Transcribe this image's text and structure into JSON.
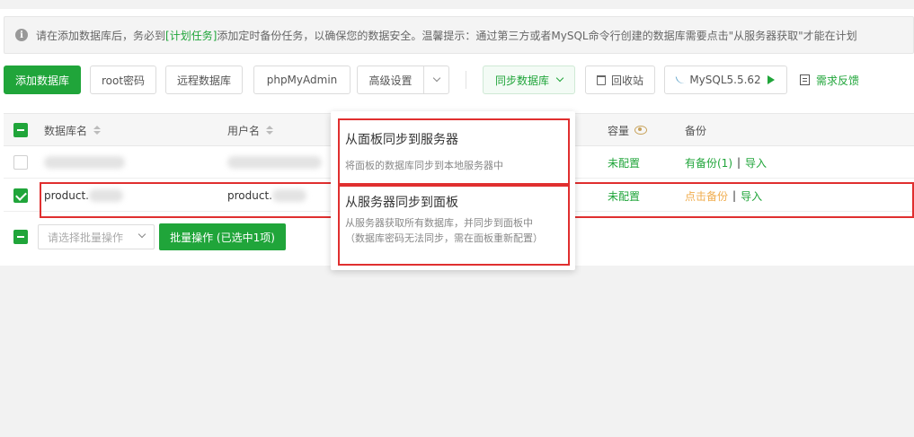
{
  "notice": {
    "text_before": "请在添加数据库后，务必到",
    "link": "[计划任务]",
    "text_after": "添加定时备份任务，以确保您的数据安全。温馨提示：通过第三方或者MySQL命令行创建的数据库需要点击\"从服务器获取\"才能在计划"
  },
  "toolbar": {
    "add_db": "添加数据库",
    "root_pwd": "root密码",
    "remote_db": "远程数据库",
    "phpmyadmin": "phpMyAdmin",
    "advanced": "高级设置",
    "sync_db": "同步数据库",
    "recycle": "回收站",
    "mysql_version": "MySQL5.5.62",
    "feedback": "需求反馈"
  },
  "table": {
    "headers": {
      "db_name": "数据库名",
      "username": "用户名",
      "capacity": "容量",
      "backup": "备份"
    },
    "rows": [
      {
        "db_name": "",
        "username": "",
        "capacity": "未配置",
        "backup_link": "有备份(1)",
        "separator": "|",
        "import": "导入",
        "checked": false
      },
      {
        "db_name": "product.",
        "username": "product.",
        "capacity": "未配置",
        "backup_link": "点击备份",
        "separator": "|",
        "import": "导入",
        "checked": true
      }
    ]
  },
  "footer": {
    "batch_placeholder": "请选择批量操作",
    "batch_button": "批量操作 (已选中1项)"
  },
  "sync_dropdown": {
    "items": [
      {
        "title": "从面板同步到服务器",
        "desc": "将面板的数据库同步到本地服务器中"
      },
      {
        "title": "从服务器同步到面板",
        "desc": "从服务器获取所有数据库，并同步到面板中",
        "desc2": "（数据库密码无法同步，需在面板重新配置）"
      }
    ]
  },
  "colors": {
    "brand_green": "#20a53a",
    "backup_orange": "#f0ad4e",
    "highlight_red": "#e02f2f"
  }
}
